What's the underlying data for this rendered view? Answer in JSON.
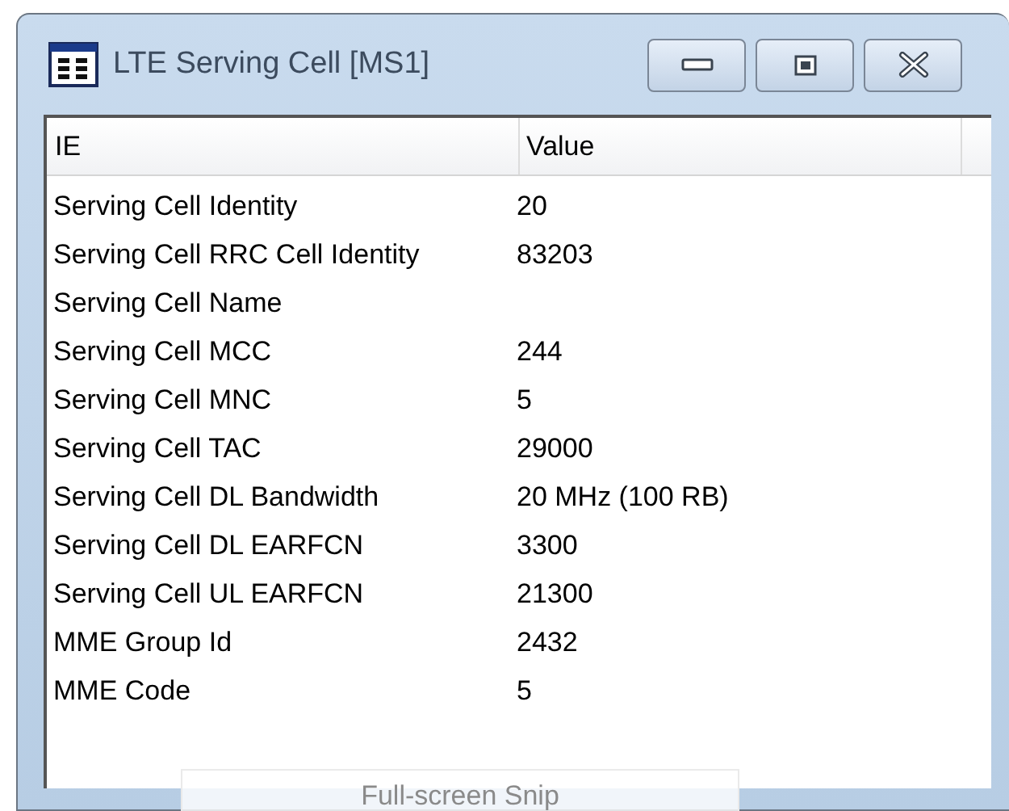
{
  "window": {
    "title": "LTE Serving Cell [MS1]"
  },
  "table": {
    "columns": [
      "IE",
      "Value"
    ],
    "rows": [
      {
        "ie": "Serving Cell Identity",
        "value": "20"
      },
      {
        "ie": "Serving Cell RRC Cell Identity",
        "value": "83203"
      },
      {
        "ie": "Serving Cell Name"
      },
      {
        "ie": "Serving Cell MCC",
        "value": "244"
      },
      {
        "ie": "Serving Cell MNC",
        "value": "5"
      },
      {
        "ie": "Serving Cell TAC",
        "value": "29000"
      },
      {
        "ie": "Serving Cell DL Bandwidth",
        "value": "20 MHz (100 RB)"
      },
      {
        "ie": "Serving Cell DL EARFCN",
        "value": "3300"
      },
      {
        "ie": "Serving Cell UL EARFCN",
        "value": "21300"
      },
      {
        "ie": "MME Group Id",
        "value": "2432"
      },
      {
        "ie": "MME Code",
        "value": "5"
      }
    ]
  },
  "tooltip": {
    "text": "Full-screen Snip"
  }
}
